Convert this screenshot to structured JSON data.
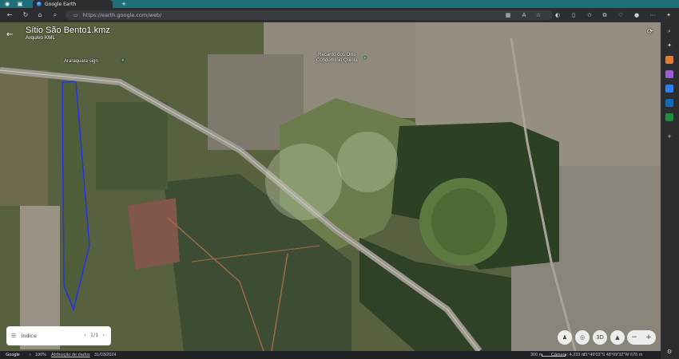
{
  "browser": {
    "tab_title": "Google Earth",
    "url": "https://earth.google.com/web/",
    "new_tab": "+"
  },
  "earth": {
    "title": "Sítio São Bento1.kmz",
    "subtitle": "Arquivo KML",
    "labels": {
      "araraquara": "Araraquara sign",
      "recanto_line1": "Recanto dos Oitis",
      "recanto_line2": "Condomínio Quinta"
    },
    "index_panel": {
      "label": "Índice",
      "page": "1/1"
    },
    "controls": {
      "three_d": "3D",
      "zoom_out": "−",
      "zoom_in": "+"
    }
  },
  "statusbar": {
    "brand": "Google",
    "zoom": "100%",
    "attribution": "Atribuição de dados",
    "date": "31/03/2024",
    "scale": "300 m",
    "camera": "Câmera: 4.233 m",
    "coords": "21°49'03\"S 48°09'32\"W 676 m"
  }
}
